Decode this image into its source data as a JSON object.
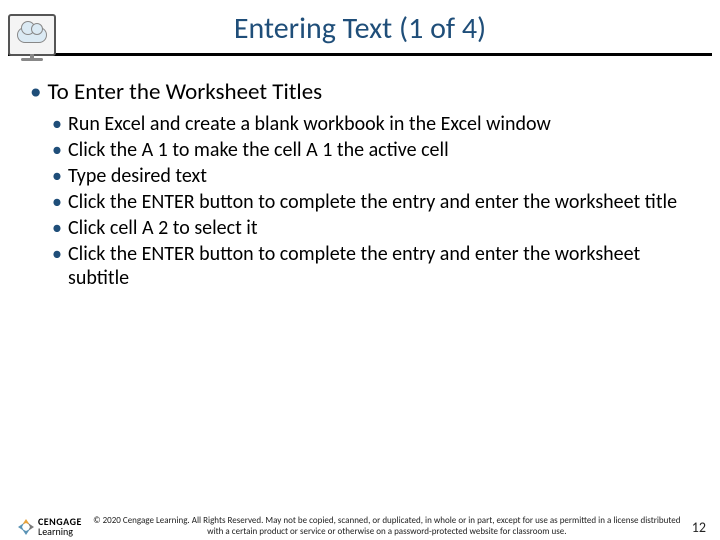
{
  "title": "Entering Text (1 of 4)",
  "heading": "To Enter the Worksheet Titles",
  "items": [
    "Run Excel and create a blank workbook in the Excel window",
    "Click the A 1 to make the cell A 1 the active cell",
    "Type desired text",
    "Click the ENTER button to complete the entry and enter the worksheet title",
    "Click cell A 2 to select it",
    "Click the ENTER button to complete the entry and enter the worksheet subtitle"
  ],
  "footer": {
    "brand_top": "CENGAGE",
    "brand_bottom": "Learning",
    "copyright": "© 2020 Cengage Learning. All Rights Reserved. May not be copied, scanned, or duplicated, in whole or in part, except for use as permitted in a license distributed with a certain product or service or otherwise on a password-protected website for classroom use.",
    "page": "12"
  }
}
